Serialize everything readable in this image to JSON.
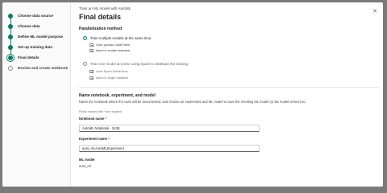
{
  "sidebar": {
    "steps": [
      {
        "label": "Choose data source",
        "state": "done"
      },
      {
        "label": "Choose data",
        "state": "done"
      },
      {
        "label": "Define ML model purpose",
        "state": "done"
      },
      {
        "label": "Set up training data",
        "state": "done"
      },
      {
        "label": "Final details",
        "state": "current"
      },
      {
        "label": "Review and create notebook",
        "state": "pending"
      }
    ]
  },
  "header": {
    "subtitle": "Train an ML model with AutoML",
    "title": "Final details",
    "close_icon": "close-icon"
  },
  "parallelization": {
    "heading": "Parallelization method",
    "option1": {
      "label": "Train multiple models at the same time",
      "checked": true,
      "sub1": "Uses pandas DataFrame",
      "sub2": "Ideal for smaller datasets"
    },
    "option2": {
      "label": "Train one model at a time using Spark to distribute the training",
      "checked": false,
      "sub1": "Uses Spark DataFrame",
      "sub2": "Ideal for larger datasets"
    }
  },
  "naming": {
    "heading": "Name notebook, experiment, and model",
    "description": "Name the notebook where the code will be documented, and choose an experiment and ML model to save the resulting ML model (or ML model version) to.",
    "required_hint": "Fields marked with * are required",
    "notebook_label": "Notebook name",
    "notebook_value": "AutoML Notebook - 5136",
    "experiment_label": "Experiment name",
    "experiment_value": "auto_ml-AutoMLExperiment",
    "model_label": "ML model",
    "model_value": "auto_ml",
    "required_mark": "*"
  },
  "colors": {
    "accent": "#117865",
    "required": "#c4314b",
    "overlay": "#7a7a7a"
  }
}
